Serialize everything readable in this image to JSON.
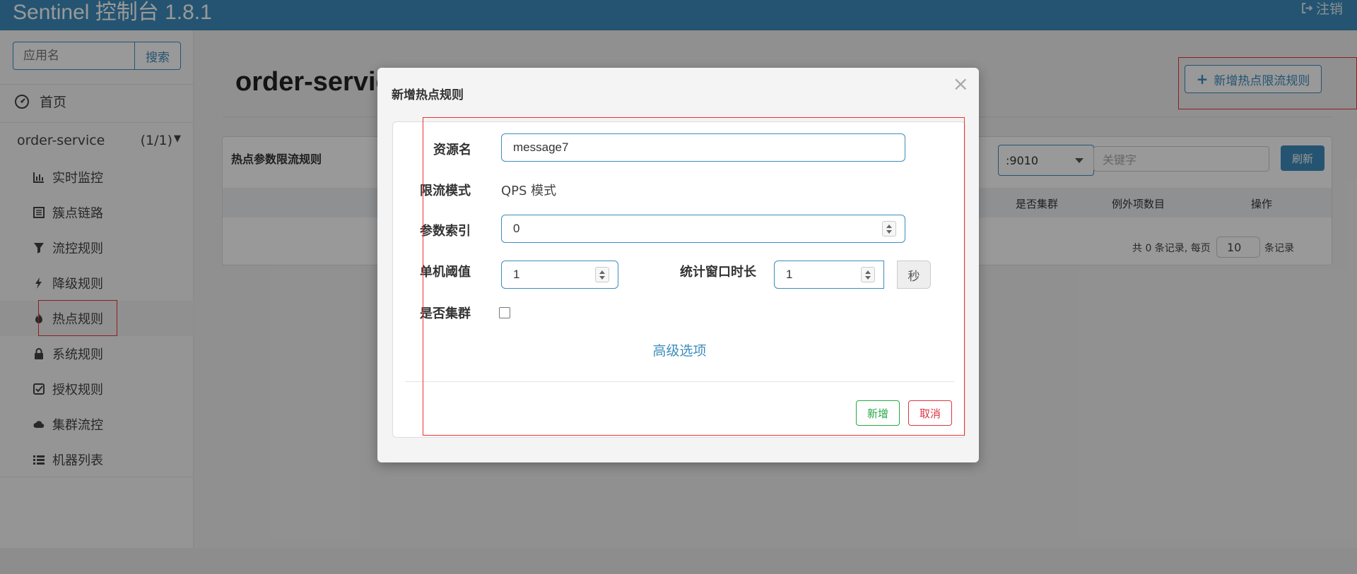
{
  "header": {
    "brand": "Sentinel 控制台 1.8.1",
    "logout_label": "注销"
  },
  "sidebar": {
    "search_placeholder": "应用名",
    "search_button": "搜索",
    "home_label": "首页",
    "app_name": "order-service",
    "app_count": "(1/1)",
    "items": [
      {
        "label": "实时监控",
        "icon": "bar-chart-icon"
      },
      {
        "label": "簇点链路",
        "icon": "list-alt-icon"
      },
      {
        "label": "流控规则",
        "icon": "filter-icon"
      },
      {
        "label": "降级规则",
        "icon": "flash-icon"
      },
      {
        "label": "热点规则",
        "icon": "fire-icon"
      },
      {
        "label": "系统规则",
        "icon": "lock-icon"
      },
      {
        "label": "授权规则",
        "icon": "check-icon"
      },
      {
        "label": "集群流控",
        "icon": "cloud-icon"
      },
      {
        "label": "机器列表",
        "icon": "list-icon"
      }
    ]
  },
  "main": {
    "page_title": "order-servic",
    "add_button": "新增热点限流规则",
    "panel_title": "热点参数限流规则",
    "machine_select": ":9010",
    "keyword_placeholder": "关键字",
    "refresh_button": "刷新",
    "columns": [
      "是否集群",
      "例外项数目",
      "操作"
    ],
    "pager_text_before": "共 0 条记录, 每页",
    "page_size": "10",
    "pager_text_after": "条记录"
  },
  "modal": {
    "title": "新增热点规则",
    "close": "×",
    "resource_label": "资源名",
    "resource_value": "message7",
    "mode_label": "限流模式",
    "mode_value": "QPS 模式",
    "param_index_label": "参数索引",
    "param_index_value": "0",
    "threshold_label": "单机阈值",
    "threshold_value": "1",
    "window_label": "统计窗口时长",
    "window_value": "1",
    "window_unit": "秒",
    "cluster_label": "是否集群",
    "cluster_checked": false,
    "advanced_link": "高级选项",
    "submit_button": "新增",
    "cancel_button": "取消"
  },
  "colors": {
    "primary": "#3c8dbc",
    "success": "#28a745",
    "danger": "#dc3545",
    "highlight_box": "#e33333"
  }
}
